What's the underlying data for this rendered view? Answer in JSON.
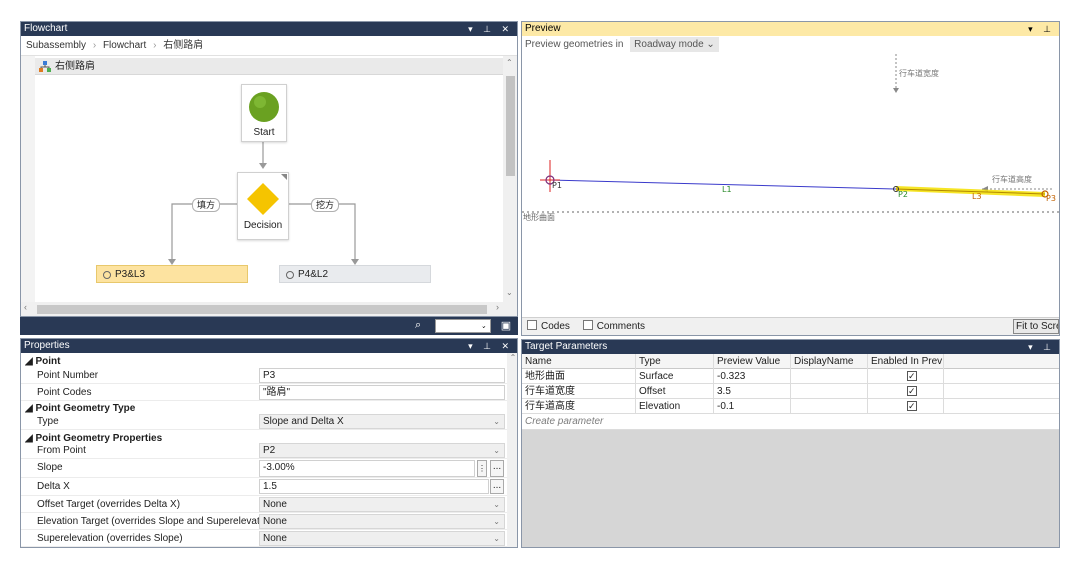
{
  "flowchart": {
    "title": "Flowchart",
    "breadcrumb": [
      "Subassembly",
      "Flowchart",
      "右侧路肩"
    ],
    "canvas_title": "右侧路肩",
    "start_label": "Start",
    "decision_label": "Decision",
    "branch_left": "填方",
    "branch_right": "挖方",
    "result_left": "P3&L3",
    "result_right": "P4&L2"
  },
  "preview": {
    "title": "Preview",
    "toolbar_label": "Preview geometries in",
    "mode": "Roadway mode",
    "labels": {
      "p1": "P1",
      "p2": "P2",
      "p3": "P3",
      "l1": "L1",
      "l3": "L3",
      "lane_width": "行车道宽度",
      "lane_height": "行车道高度",
      "surface": "地形曲面"
    },
    "codes_label": "Codes",
    "comments_label": "Comments",
    "fit_label": "Fit to Scre"
  },
  "properties": {
    "title": "Properties",
    "cat_point": "Point",
    "point_number_label": "Point Number",
    "point_number_value": "P3",
    "point_codes_label": "Point Codes",
    "point_codes_value": "\"路肩\"",
    "cat_geom_type": "Point Geometry Type",
    "type_label": "Type",
    "type_value": "Slope and Delta X",
    "cat_geom_props": "Point Geometry Properties",
    "from_point_label": "From Point",
    "from_point_value": "P2",
    "slope_label": "Slope",
    "slope_value": "-3.00%",
    "delta_x_label": "Delta X",
    "delta_x_value": "1.5",
    "offset_target_label": "Offset Target (overrides Delta X)",
    "offset_target_value": "None",
    "elev_target_label": "Elevation Target (overrides Slope and Superelevati",
    "elev_target_value": "None",
    "superelev_label": "Superelevation (overrides Slope)",
    "superelev_value": "None"
  },
  "target": {
    "title": "Target Parameters",
    "headers": [
      "Name",
      "Type",
      "Preview Value",
      "DisplayName",
      "Enabled In Prev"
    ],
    "rows": [
      {
        "name": "地形曲面",
        "type": "Surface",
        "value": "-0.323"
      },
      {
        "name": "行车道宽度",
        "type": "Offset",
        "value": "3.5"
      },
      {
        "name": "行车道高度",
        "type": "Elevation",
        "value": "-0.1"
      }
    ],
    "create_label": "Create parameter"
  },
  "colors": {
    "title_bar": "#293955",
    "active_title": "#fde9a6",
    "start_node": "#6aa121",
    "decision_node": "#f5c400",
    "result_selected": "#fde3a0",
    "result_normal": "#e9ebee",
    "preview_line": "#3a3acb",
    "highlight_segment": "#f4e100"
  }
}
